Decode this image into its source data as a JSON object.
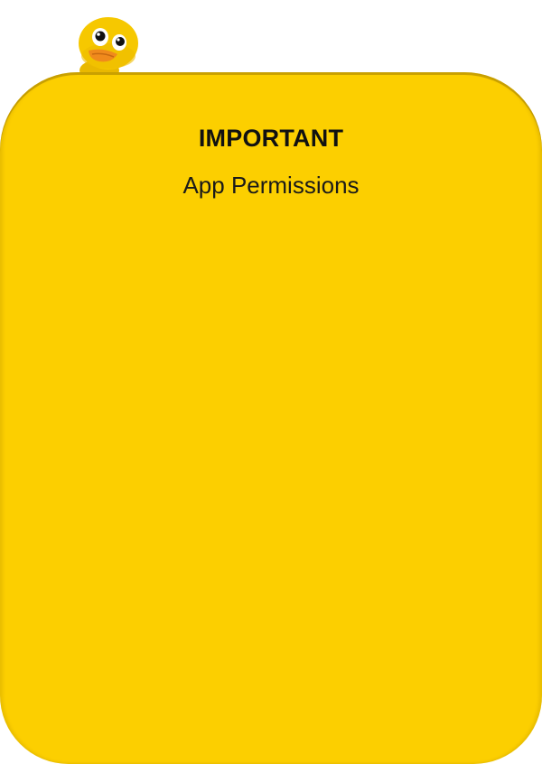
{
  "dialog": {
    "heading": "IMPORTANT",
    "subheading": "App Permissions"
  },
  "mascot": {
    "icon": "duck-mascot-icon"
  },
  "colors": {
    "card_background": "#fccf00",
    "page_background": "#ffffff",
    "text": "#111111",
    "mascot_body": "#f6c800",
    "mascot_beak": "#f08a1c"
  }
}
